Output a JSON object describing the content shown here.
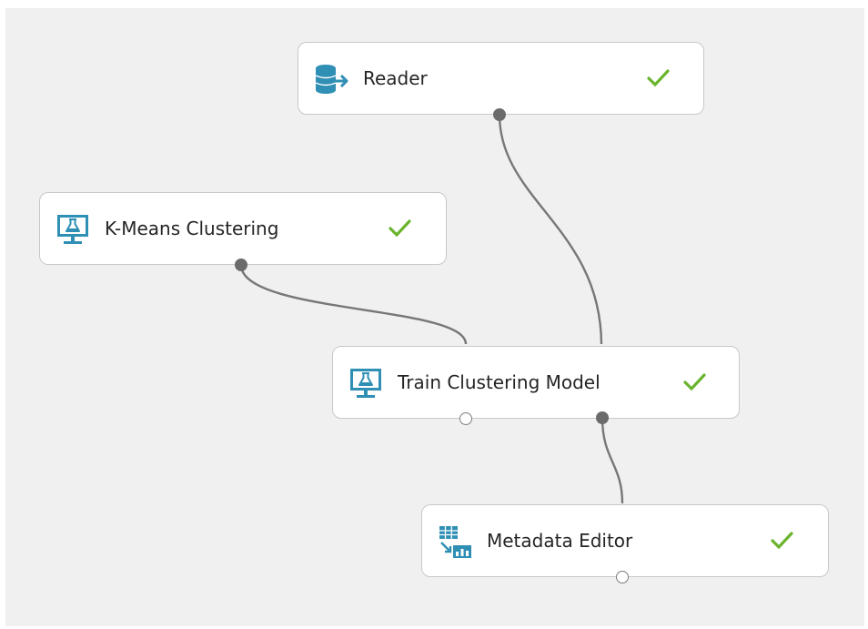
{
  "experiment": {
    "modules": [
      {
        "label": "Reader",
        "icon": "database-arrow-icon",
        "status": "completed"
      },
      {
        "label": "K-Means Clustering",
        "icon": "flask-monitor-icon",
        "status": "completed"
      },
      {
        "label": "Train Clustering Model",
        "icon": "flask-monitor-icon",
        "status": "completed"
      },
      {
        "label": "Metadata Editor",
        "icon": "table-chart-icon",
        "status": "completed"
      }
    ]
  },
  "colors": {
    "canvas": "#f0f0f0",
    "icon_blue": "#2f8fb4",
    "check_green": "#6ab42d",
    "connector": "#6b6b6b"
  }
}
